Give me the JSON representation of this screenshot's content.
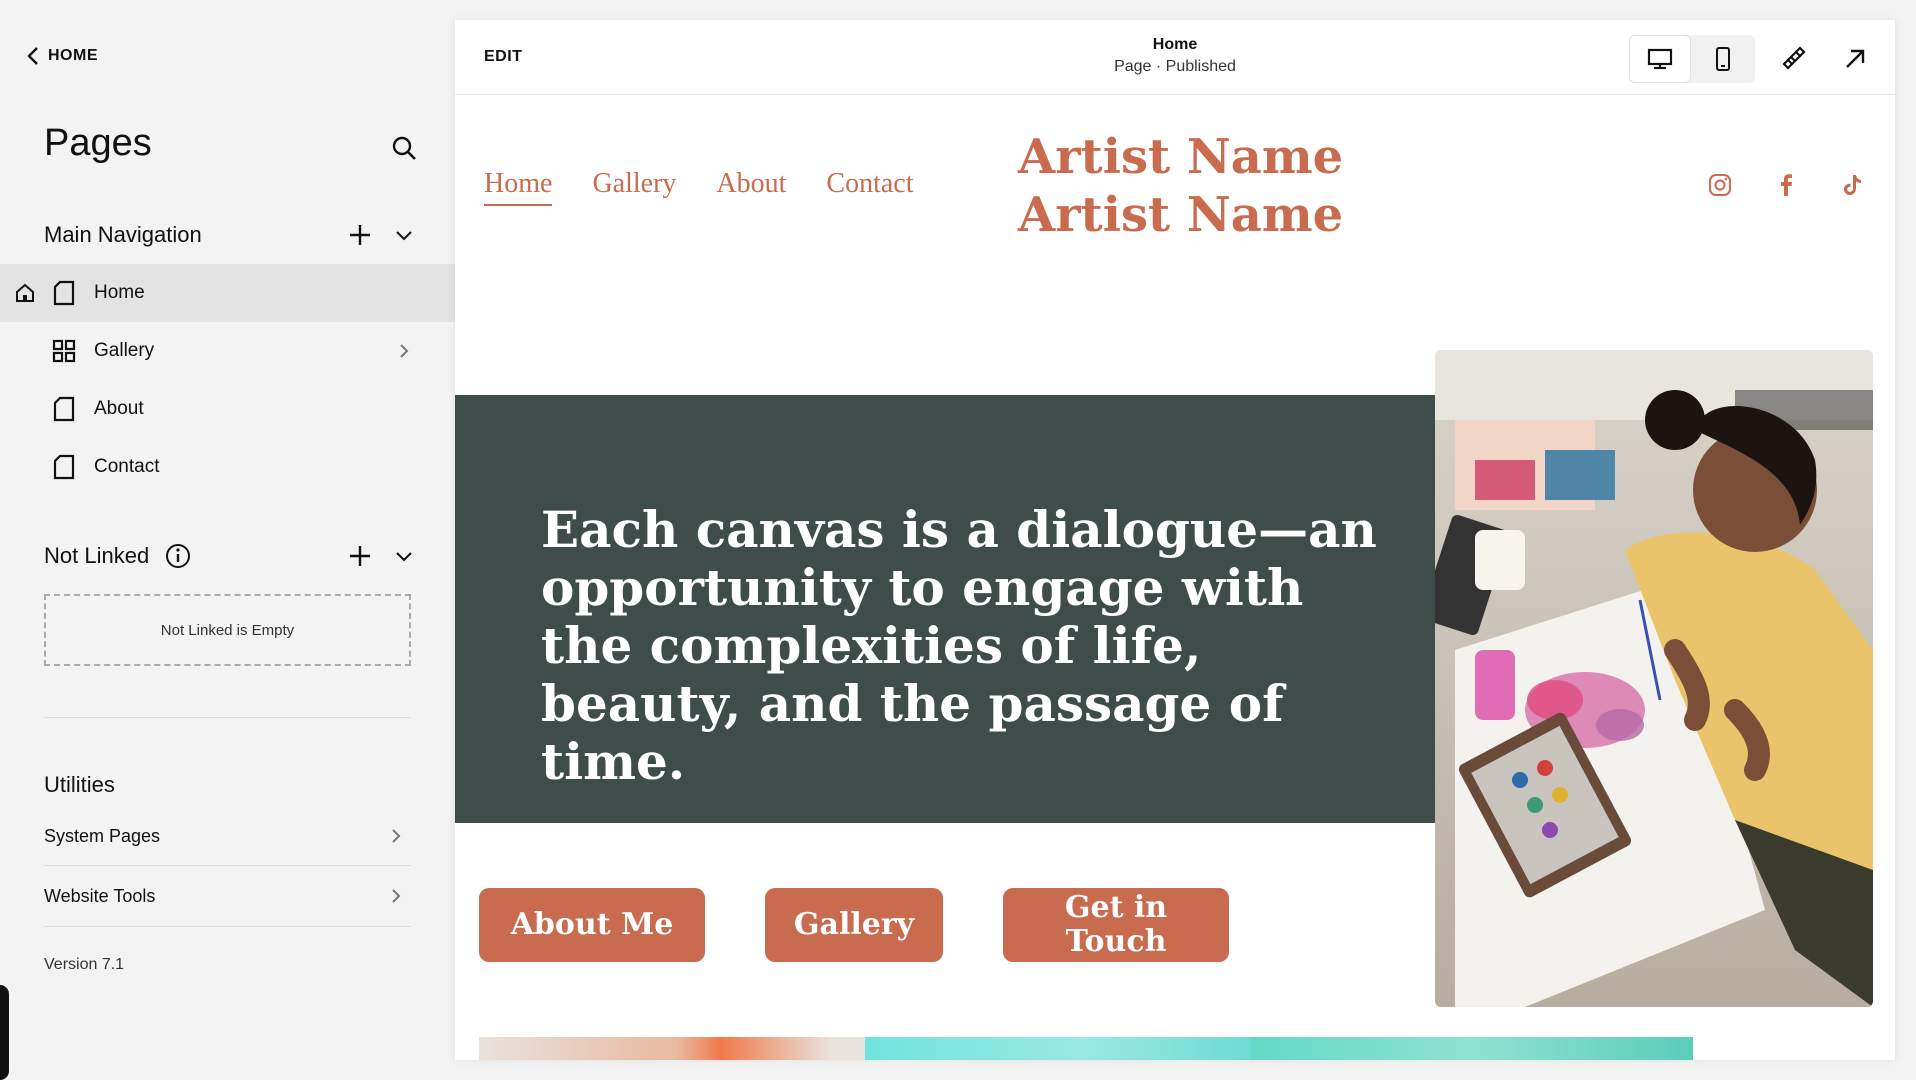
{
  "sidebar": {
    "back_label": "HOME",
    "title": "Pages",
    "main_nav": {
      "label": "Main Navigation",
      "items": [
        {
          "label": "Home",
          "icon": "page-icon"
        },
        {
          "label": "Gallery",
          "icon": "grid-icon"
        },
        {
          "label": "About",
          "icon": "page-icon"
        },
        {
          "label": "Contact",
          "icon": "page-icon"
        }
      ]
    },
    "not_linked": {
      "label": "Not Linked",
      "empty_text": "Not Linked is Empty"
    },
    "utilities": {
      "label": "Utilities",
      "items": [
        {
          "label": "System Pages"
        },
        {
          "label": "Website Tools"
        }
      ]
    },
    "version": "Version 7.1"
  },
  "toolbar": {
    "edit_label": "EDIT",
    "page_title": "Home",
    "page_status": "Page · Published"
  },
  "site": {
    "accent": "#c96b4e",
    "dark_block": "#3e4c4a",
    "nav": [
      "Home",
      "Gallery",
      "About",
      "Contact"
    ],
    "title_line1": "Artist Name",
    "title_line2": "Artist Name",
    "social": [
      "instagram-icon",
      "facebook-icon",
      "tiktok-icon"
    ],
    "quote": "Each canvas is a dialogue—an opportunity to engage with the complexities of life, beauty, and the passage of time.",
    "buttons": [
      "About Me",
      "Gallery",
      "Get in Touch"
    ]
  }
}
